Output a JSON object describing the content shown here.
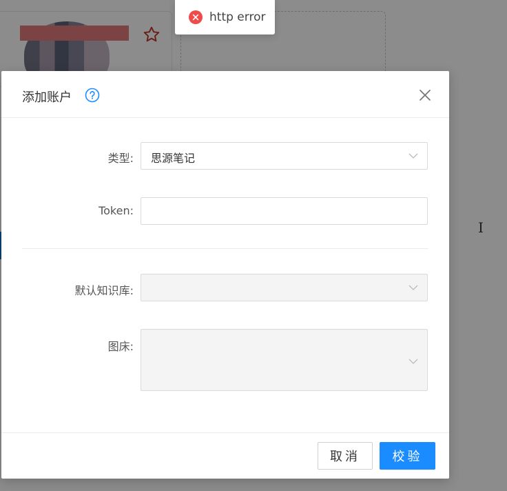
{
  "toast": {
    "message": "http error",
    "icon": "error-circle-icon",
    "color": "#f04b4b"
  },
  "dialog": {
    "title": "添加账户",
    "help_icon": "question-circle-icon",
    "close_icon": "close-icon"
  },
  "form": {
    "type_label": "类型:",
    "type_value": "思源笔记",
    "token_label": "Token:",
    "token_value": "",
    "token_placeholder": "",
    "notebook_label": "默认知识库:",
    "notebook_value": "",
    "image_host_label": "图床:",
    "image_host_value": ""
  },
  "footer": {
    "cancel_label": "取消",
    "verify_label": "校验"
  },
  "colors": {
    "primary": "#1a8cff",
    "help_icon": "#1a8cff",
    "error": "#f04b4b",
    "overlay": "rgba(0,0,0,0.45)",
    "star": "#c0392b"
  }
}
